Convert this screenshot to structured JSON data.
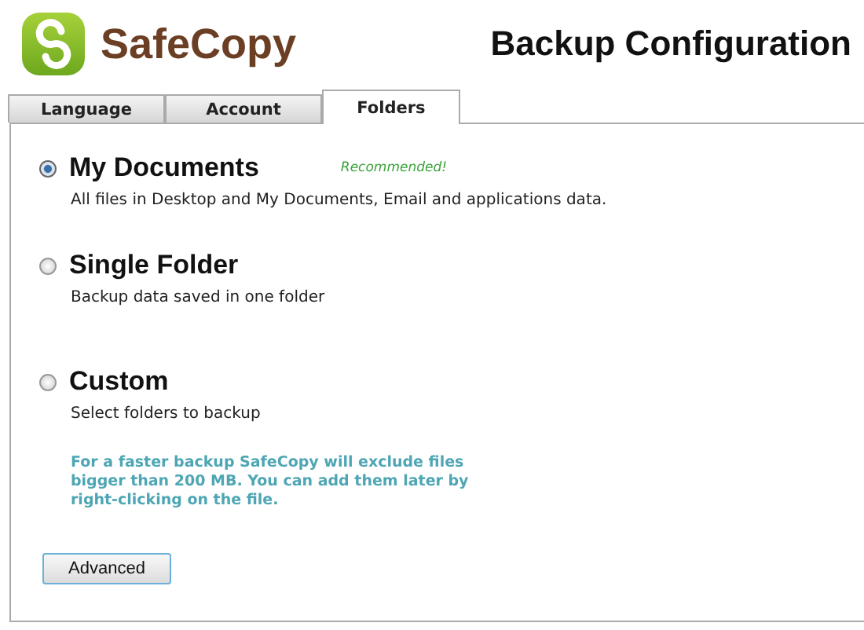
{
  "app": {
    "name": "SafeCopy"
  },
  "window": {
    "title": "Backup Configuration"
  },
  "tabs": [
    {
      "label": "Language",
      "selected": false
    },
    {
      "label": "Account",
      "selected": false
    },
    {
      "label": "Folders",
      "selected": true
    }
  ],
  "options": [
    {
      "title": "My Documents",
      "badge": "Recommended!",
      "description": "All files in Desktop and My Documents, Email and applications data.",
      "selected": true
    },
    {
      "title": "Single Folder",
      "description": "Backup data saved in one folder",
      "selected": false
    },
    {
      "title": "Custom",
      "description": "Select folders to backup",
      "selected": false
    }
  ],
  "note": "For a faster backup SafeCopy will exclude files bigger than 200 MB. You can add them later by right-clicking on the file.",
  "buttons": [
    "Advanced"
  ]
}
